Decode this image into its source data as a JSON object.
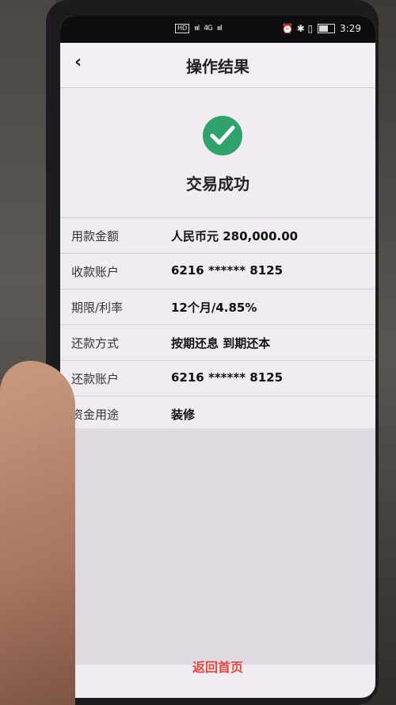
{
  "statusbar": {
    "left_badge": "HD",
    "signal1": "ıııl",
    "net": "4G",
    "signal2": "ıııl",
    "icons_right": "⏰ ✱ ▯",
    "time": "3:29"
  },
  "navbar": {
    "back_icon": "‹",
    "title": "操作结果"
  },
  "result": {
    "status_text": "交易成功",
    "success_color": "#2fa36b"
  },
  "details": [
    {
      "label": "用款金额",
      "value": "人民币元 280,000.00"
    },
    {
      "label": "收款账户",
      "value": "6216 ****** 8125"
    },
    {
      "label": "期限/利率",
      "value": "12个月/4.85%"
    },
    {
      "label": "还款方式",
      "value": "按期还息 到期还本"
    },
    {
      "label": "还款账户",
      "value": "6216 ****** 8125"
    },
    {
      "label": "资金用途",
      "value": "装修"
    }
  ],
  "footer": {
    "home_label": "返回首页",
    "accent": "#e0483e"
  }
}
